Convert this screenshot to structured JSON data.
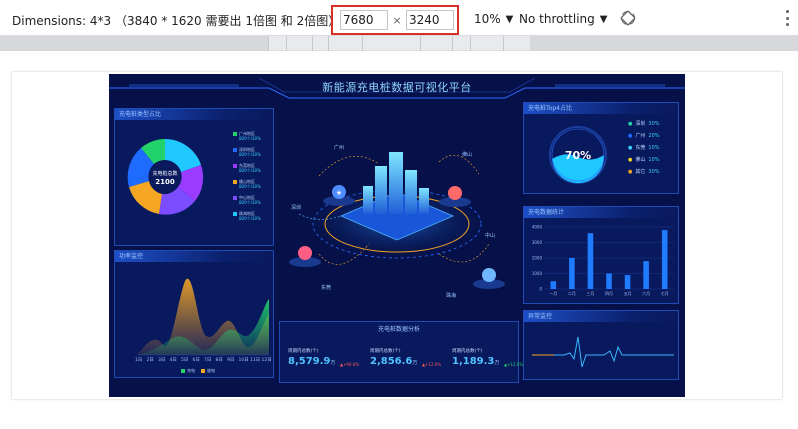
{
  "toolbar": {
    "dimensions_label": "Dimensions: 4*3 （3840 * 1620 需要出 1倍图 和 2倍图）",
    "width_value": "7680",
    "times": "×",
    "height_value": "3240",
    "zoom": "10%",
    "throttling": "No throttling",
    "rotate_icon": "rotate-icon",
    "more_icon": "more-vertical-icon"
  },
  "dashboard": {
    "title": "新能源充电桩数据可视化平台",
    "donut_panel": {
      "title": "充电桩类型占比",
      "center_label": "充电桩总数",
      "center_value": "2100",
      "legend": [
        {
          "name": "广州地区",
          "sub": "800个/30%",
          "color": "#22d36b"
        },
        {
          "name": "深圳地区",
          "sub": "800个/30%",
          "color": "#1f6bff"
        },
        {
          "name": "东莞地区",
          "sub": "800个/30%",
          "color": "#9a3cff"
        },
        {
          "name": "佛山地区",
          "sub": "800个/30%",
          "color": "#f5a623"
        },
        {
          "name": "中山地区",
          "sub": "800个/30%",
          "color": "#7c4dff"
        },
        {
          "name": "珠海地区",
          "sub": "800个/30%",
          "color": "#1fc8ff"
        }
      ]
    },
    "area_panel": {
      "title": "功率监控",
      "x_labels": [
        "1日",
        "2日",
        "3日",
        "4日",
        "5日",
        "6日",
        "7日",
        "8日",
        "9日",
        "10日",
        "11日",
        "12日"
      ],
      "legend": [
        {
          "name": "充电",
          "color": "#22d36b"
        },
        {
          "name": "放电",
          "color": "#f5a623"
        }
      ]
    },
    "cities": [
      "广州",
      "佛山",
      "深圳",
      "中山",
      "东莞",
      "珠海"
    ],
    "stats_panel": {
      "title": "充电桩数据分析",
      "items": [
        {
          "label": "周期内总数(个)",
          "value": "8,579.9",
          "unit": "万",
          "change": "+90.0%",
          "change_color": "#ff5a5a"
        },
        {
          "label": "周期内总数(个)",
          "value": "2,856.6",
          "unit": "万",
          "change": "+12.0%",
          "change_color": "#ff5a5a"
        },
        {
          "label": "周期内总数(个)",
          "value": "1,189.3",
          "unit": "万",
          "change": "+12.0%",
          "change_color": "#22d36b"
        }
      ]
    },
    "top4_panel": {
      "title": "充电桩Top4占比",
      "percent": "70%",
      "items": [
        {
          "name": "深圳",
          "pct": "30%",
          "color": "#22d3a0"
        },
        {
          "name": "广州",
          "pct": "20%",
          "color": "#1f6bff"
        },
        {
          "name": "东莞",
          "pct": "10%",
          "color": "#39d0ff"
        },
        {
          "name": "佛山",
          "pct": "10%",
          "color": "#f5d623"
        },
        {
          "name": "其它",
          "pct": "30%",
          "color": "#f5a623"
        }
      ]
    },
    "bar_panel": {
      "title": "充电数据统计"
    },
    "wave_panel": {
      "title": "异常监控"
    }
  },
  "chart_data": {
    "type": "bar",
    "categories": [
      "一月",
      "二月",
      "三月",
      "四月",
      "五月",
      "六月",
      "七月"
    ],
    "values": [
      500,
      2000,
      3600,
      1000,
      900,
      1800,
      3800
    ],
    "ylim": [
      0,
      4000
    ],
    "y_ticks": [
      "0",
      "1000",
      "2000",
      "3000",
      "4000"
    ]
  }
}
